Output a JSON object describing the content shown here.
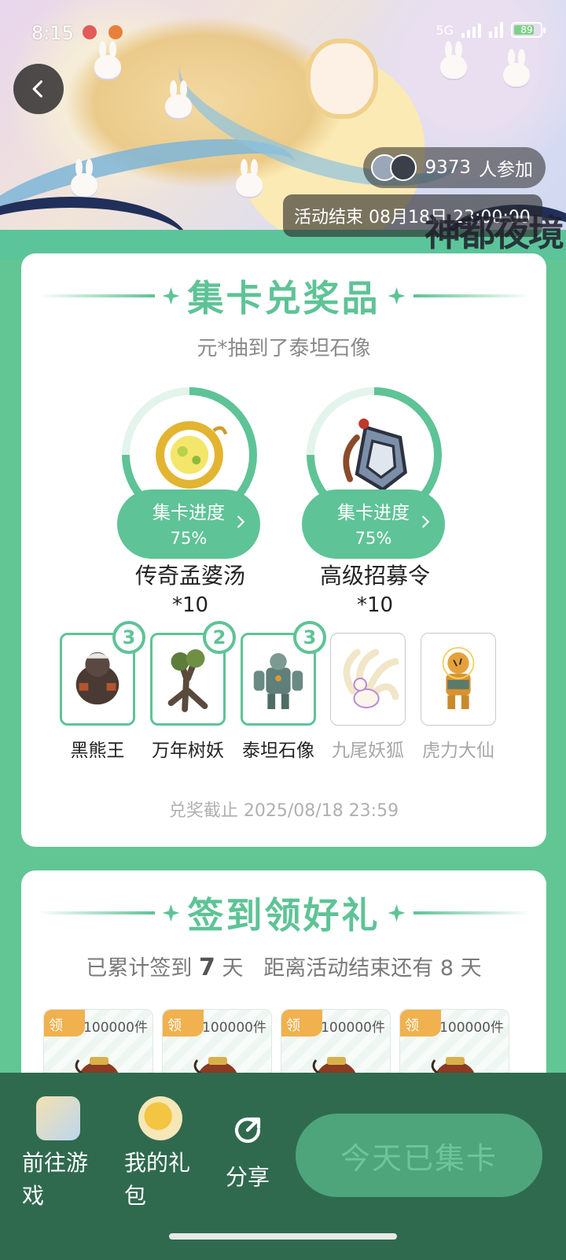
{
  "status_bar": {
    "time": "8:15",
    "network": "5G",
    "battery": "89"
  },
  "hero": {
    "participants_count": "9373",
    "participants_suffix": "人参加",
    "event_end": "活动结束 08月18日 23:00:00",
    "game_logo": "神都夜境"
  },
  "exchange_section": {
    "title": "集卡兑奖品",
    "subtitle": "元*抽到了泰坦石像",
    "rewards": [
      {
        "name": "传奇孟婆汤",
        "qty": "*10",
        "progress_label": "集卡进度",
        "progress_value": "75%",
        "progress": 0.75,
        "icon": "soup-bowl-icon"
      },
      {
        "name": "高级招募令",
        "qty": "*10",
        "progress_label": "集卡进度",
        "progress_value": "75%",
        "progress": 0.75,
        "icon": "recruit-token-icon"
      }
    ],
    "cards": [
      {
        "name": "黑熊王",
        "count": "3",
        "collected": true
      },
      {
        "name": "万年树妖",
        "count": "2",
        "collected": true
      },
      {
        "name": "泰坦石像",
        "count": "3",
        "collected": true
      },
      {
        "name": "九尾妖狐",
        "count": "",
        "collected": false
      },
      {
        "name": "虎力大仙",
        "count": "",
        "collected": false
      }
    ],
    "deadline": "兑奖截止 2025/08/18 23:59"
  },
  "checkin_section": {
    "title": "签到领好礼",
    "checked_prefix": "已累计签到",
    "checked_days": "7",
    "checked_suffix": "天",
    "remaining_prefix": "距离活动结束还有",
    "remaining_days": "8",
    "remaining_suffix": "天",
    "gifts": [
      {
        "tag": "领",
        "count": "100000件"
      },
      {
        "tag": "领",
        "count": "100000件"
      },
      {
        "tag": "领",
        "count": "100000件"
      },
      {
        "tag": "领",
        "count": "100000件"
      }
    ]
  },
  "bottom_bar": {
    "goto_game": "前往游戏",
    "my_gifts": "我的礼包",
    "share": "分享",
    "collect_button": "今天已集卡"
  },
  "colors": {
    "accent": "#5ec396",
    "dark_bar": "#2f6a4f",
    "badge_orange": "#f0b14e"
  }
}
